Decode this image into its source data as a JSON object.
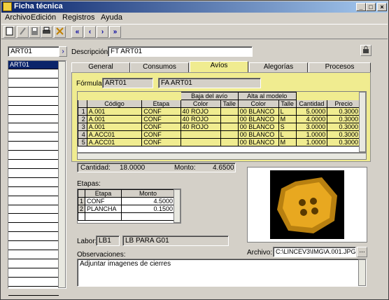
{
  "window": {
    "title": "Ficha técnica"
  },
  "menu": [
    "Archivo",
    "Edición",
    "Registros",
    "Ayuda"
  ],
  "toolbar": {
    "nav_first": "«",
    "nav_prev": "‹",
    "nav_next": "›",
    "nav_last": "»"
  },
  "code_selector": {
    "value": "ART01"
  },
  "description": {
    "label": "Descripción:",
    "value": "FT ART01"
  },
  "left_list": {
    "items": [
      "ART01"
    ]
  },
  "tabs": [
    "General",
    "Consumos",
    "Avíos",
    "Alegorías",
    "Procesos"
  ],
  "formula": {
    "label": "Fórmula:",
    "code": "ART01",
    "name": "FA ART01"
  },
  "avios_grid": {
    "group_baja": "Baja del avío",
    "group_alta": "Alta al modelo",
    "headers": [
      "Código",
      "Etapa",
      "Color",
      "Talle",
      "Color",
      "Talle",
      "Cantidad",
      "Precio"
    ],
    "rows": [
      {
        "n": "1",
        "codigo": "A.001",
        "etapa": "CONF",
        "color_baja": "40 ROJO",
        "talle_baja": "",
        "color_alta": "00 BLANCO",
        "talle_alta": "L",
        "cantidad": "5.0000",
        "precio": "0.3000"
      },
      {
        "n": "2",
        "codigo": "A.001",
        "etapa": "CONF",
        "color_baja": "40 ROJO",
        "talle_baja": "",
        "color_alta": "00 BLANCO",
        "talle_alta": "M",
        "cantidad": "4.0000",
        "precio": "0.3000"
      },
      {
        "n": "3",
        "codigo": "A.001",
        "etapa": "CONF",
        "color_baja": "40 ROJO",
        "talle_baja": "",
        "color_alta": "00 BLANCO",
        "talle_alta": "S",
        "cantidad": "3.0000",
        "precio": "0.3000"
      },
      {
        "n": "4",
        "codigo": "A.ACC01",
        "etapa": "CONF",
        "color_baja": "",
        "talle_baja": "",
        "color_alta": "00 BLANCO",
        "talle_alta": "L",
        "cantidad": "1.0000",
        "precio": "0.3000"
      },
      {
        "n": "5",
        "codigo": "A.ACC01",
        "etapa": "CONF",
        "color_baja": "",
        "talle_baja": "",
        "color_alta": "00 BLANCO",
        "talle_alta": "M",
        "cantidad": "1.0000",
        "precio": "0.3000"
      }
    ]
  },
  "totals": {
    "cantidad_label": "Cantidad:",
    "cantidad": "18.0000",
    "monto_label": "Monto:",
    "monto": "4.6500"
  },
  "etapas": {
    "label": "Etapas:",
    "headers": [
      "Etapa",
      "Monto"
    ],
    "rows": [
      {
        "n": "1",
        "etapa": "CONF",
        "monto": "4.5000"
      },
      {
        "n": "2",
        "etapa": "PLANCHA",
        "monto": "0.1500"
      }
    ]
  },
  "labor": {
    "label": "Labor:",
    "code": "LB1",
    "name": "LB PARA G01"
  },
  "archivo": {
    "label": "Archivo:",
    "value": "C:\\LINCEV3\\IMG\\A.001.JPG",
    "browse": "..."
  },
  "observaciones": {
    "label": "Observaciones:",
    "value": "Adjuntar imagenes de cierres"
  },
  "colors": {
    "highlight": "#f0ec90",
    "button": "#d4a020",
    "titlebar": "#0a246a"
  }
}
